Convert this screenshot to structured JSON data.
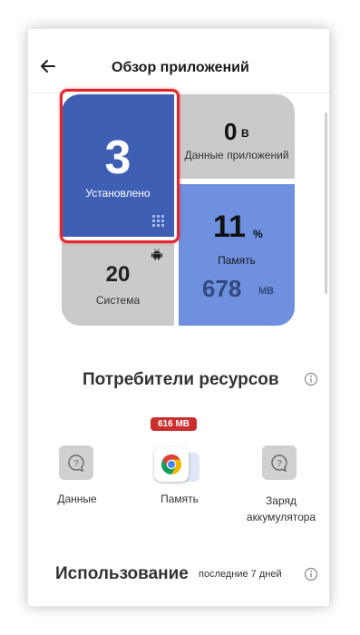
{
  "header": {
    "title": "Обзор приложений"
  },
  "tiles": {
    "installed": {
      "value": "3",
      "label": "Установлено"
    },
    "app_data": {
      "value": "0",
      "unit": "B",
      "label": "Данные приложений"
    },
    "system": {
      "value": "20",
      "label": "Система"
    },
    "memory": {
      "percent": "11",
      "percent_unit": "%",
      "label": "Память",
      "amount": "678",
      "amount_unit": "MB"
    }
  },
  "resources": {
    "title": "Потребители ресурсов",
    "badge": "616 MB",
    "items": [
      {
        "label": "Данные",
        "icon": "question-chat-icon"
      },
      {
        "label": "Память",
        "icon": "chrome-icon"
      },
      {
        "label": "Заряд\nаккумулятора",
        "icon": "question-chat-icon"
      }
    ]
  },
  "usage": {
    "title": "Использование",
    "period": "последние 7 дней"
  },
  "colors": {
    "installed_tile": "#3f5fb5",
    "memory_tile": "#6f90de",
    "gray_tile": "#cacaca",
    "highlight": "#e2262b",
    "badge": "#c9302c"
  }
}
